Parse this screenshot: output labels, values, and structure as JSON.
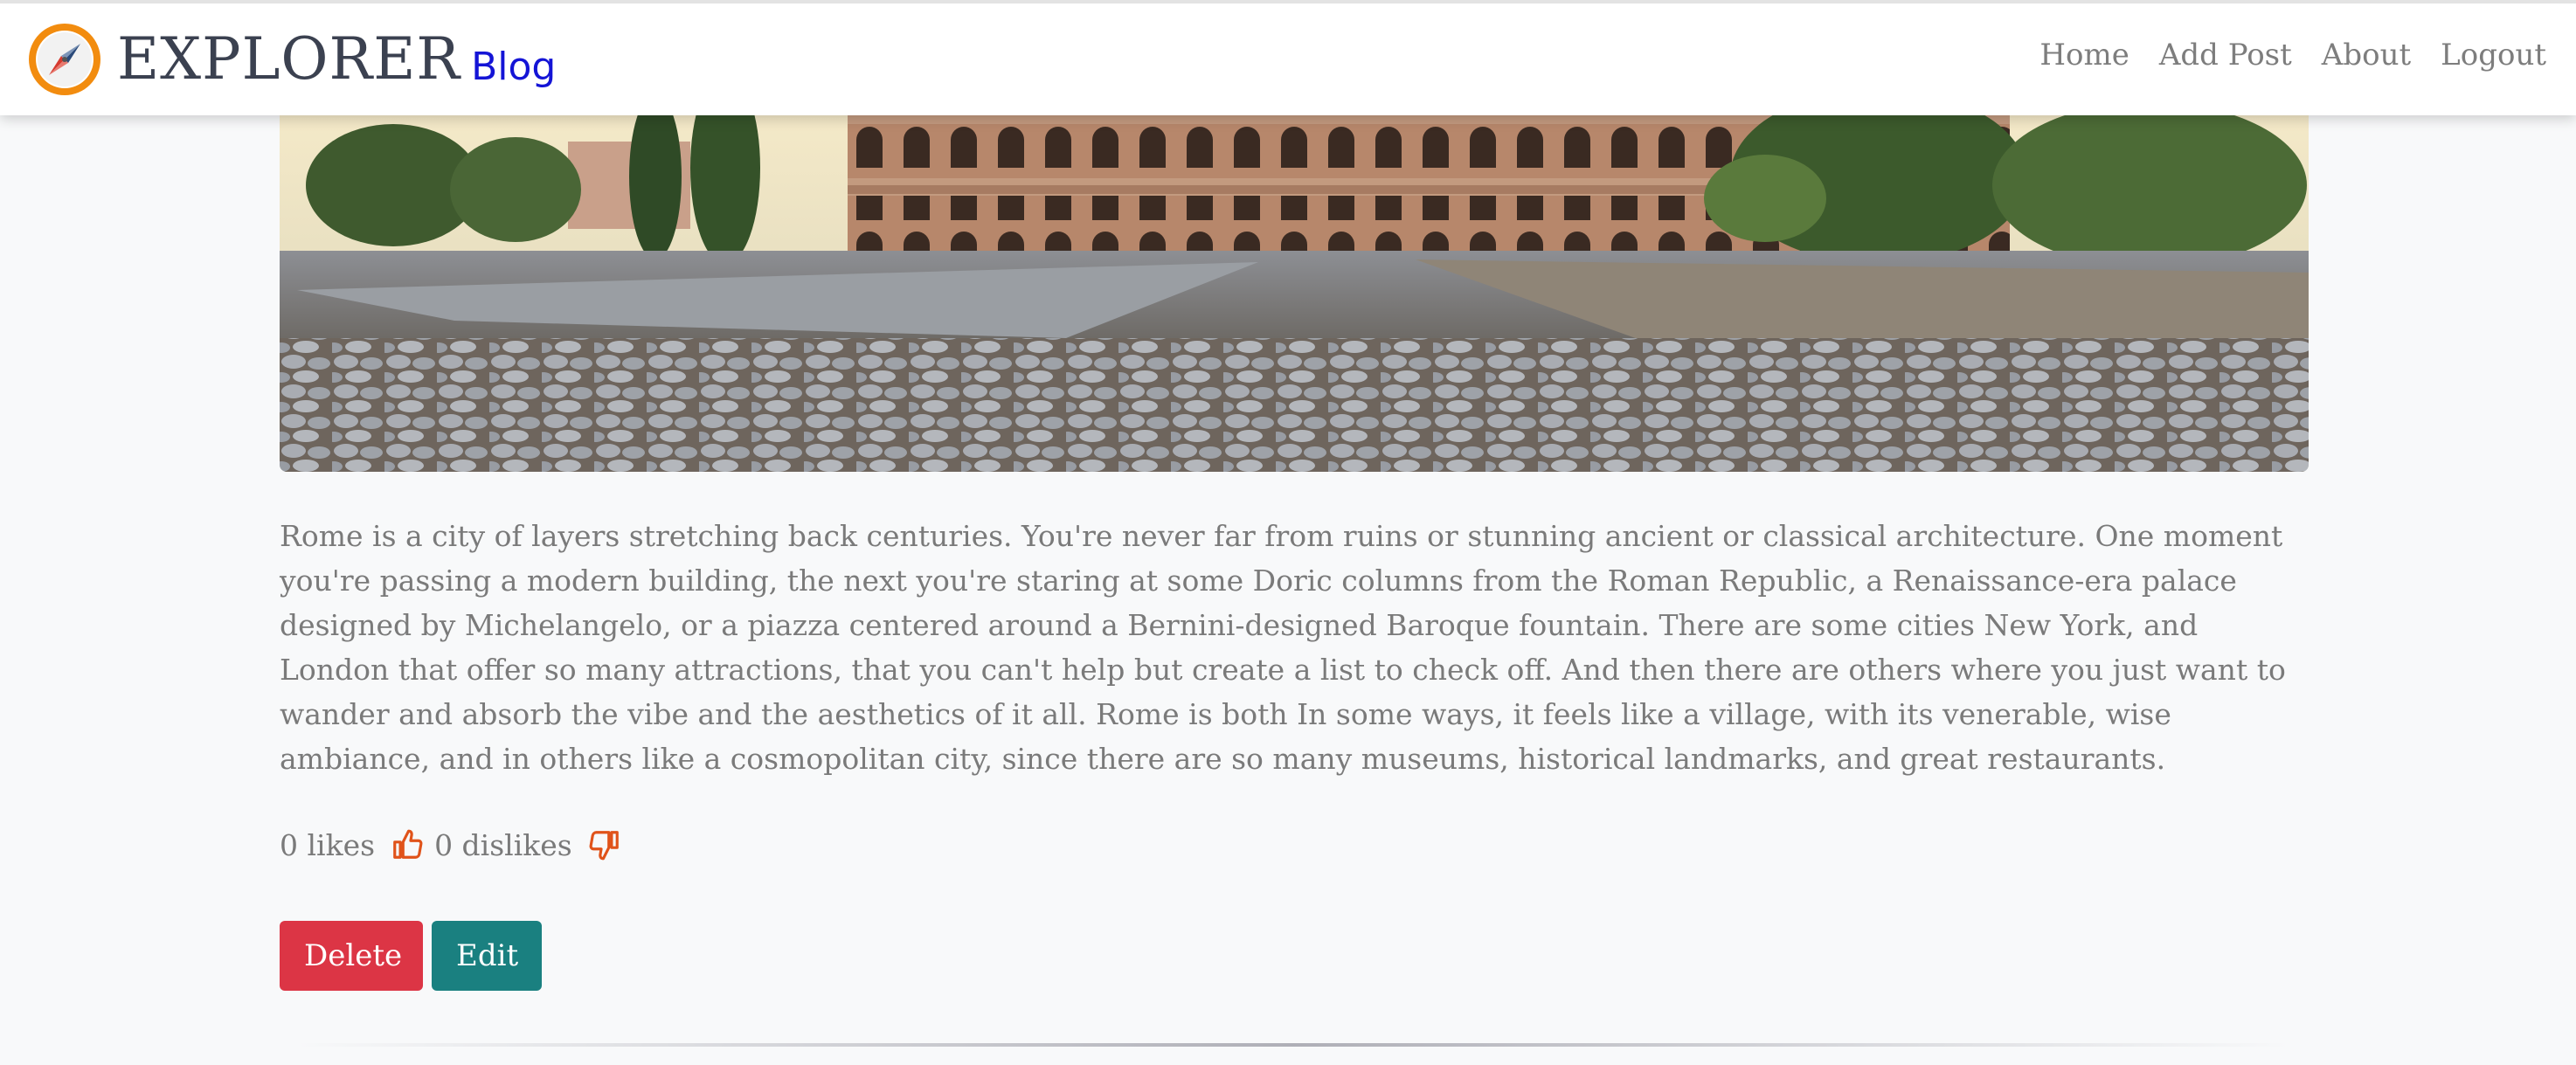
{
  "navbar": {
    "brand_name": "EXPLORER",
    "brand_sub": "Blog",
    "links": [
      {
        "label": "Home"
      },
      {
        "label": "Add Post"
      },
      {
        "label": "About"
      },
      {
        "label": "Logout"
      }
    ]
  },
  "post": {
    "body": "Rome is a city of layers stretching back centuries. You're never far from ruins or stunning ancient or classical architecture. One moment you're passing a modern building, the next you're staring at some Doric columns from the Roman Republic, a Renaissance-era palace designed by Michelangelo, or a piazza centered around a Bernini-designed Baroque fountain. There are some cities New York, and London that offer so many attractions, that you can't help but create a list to check off. And then there are others where you just want to wander and absorb the vibe and the aesthetics of it all. Rome is both In some ways, it feels like a village, with its venerable, wise ambiance, and in others like a cosmopolitan city, since there are so many museums, historical landmarks, and great restaurants.",
    "likes_text": "0 likes",
    "dislikes_text": "0 dislikes"
  },
  "buttons": {
    "delete_label": "Delete",
    "edit_label": "Edit"
  },
  "colors": {
    "brand_sub": "#1414d6",
    "delete": "#dc3545",
    "edit": "#1a8080",
    "thumb_icon": "#e0531a"
  },
  "icons": {
    "logo": "compass-icon",
    "like": "thumbs-up-icon",
    "dislike": "thumbs-down-icon"
  }
}
